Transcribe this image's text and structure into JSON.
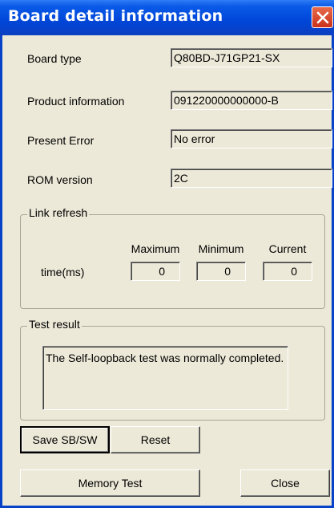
{
  "window": {
    "title": "Board detail information"
  },
  "fields": {
    "board_type_label": "Board type",
    "board_type_value": "Q80BD-J71GP21-SX",
    "product_info_label": "Product information",
    "product_info_value": "091220000000000-B",
    "present_error_label": "Present Error",
    "present_error_value": "No error",
    "rom_version_label": "ROM version",
    "rom_version_value": "2C"
  },
  "link_refresh": {
    "legend": "Link refresh",
    "row_label": "time(ms)",
    "headers": [
      "Maximum",
      "Minimum",
      "Current"
    ],
    "values": [
      "0",
      "0",
      "0"
    ]
  },
  "test_result": {
    "legend": "Test result",
    "text": "The Self-loopback test was normally completed."
  },
  "buttons": {
    "save": "Save SB/SW",
    "reset": "Reset",
    "memory_test": "Memory Test",
    "close": "Close"
  }
}
